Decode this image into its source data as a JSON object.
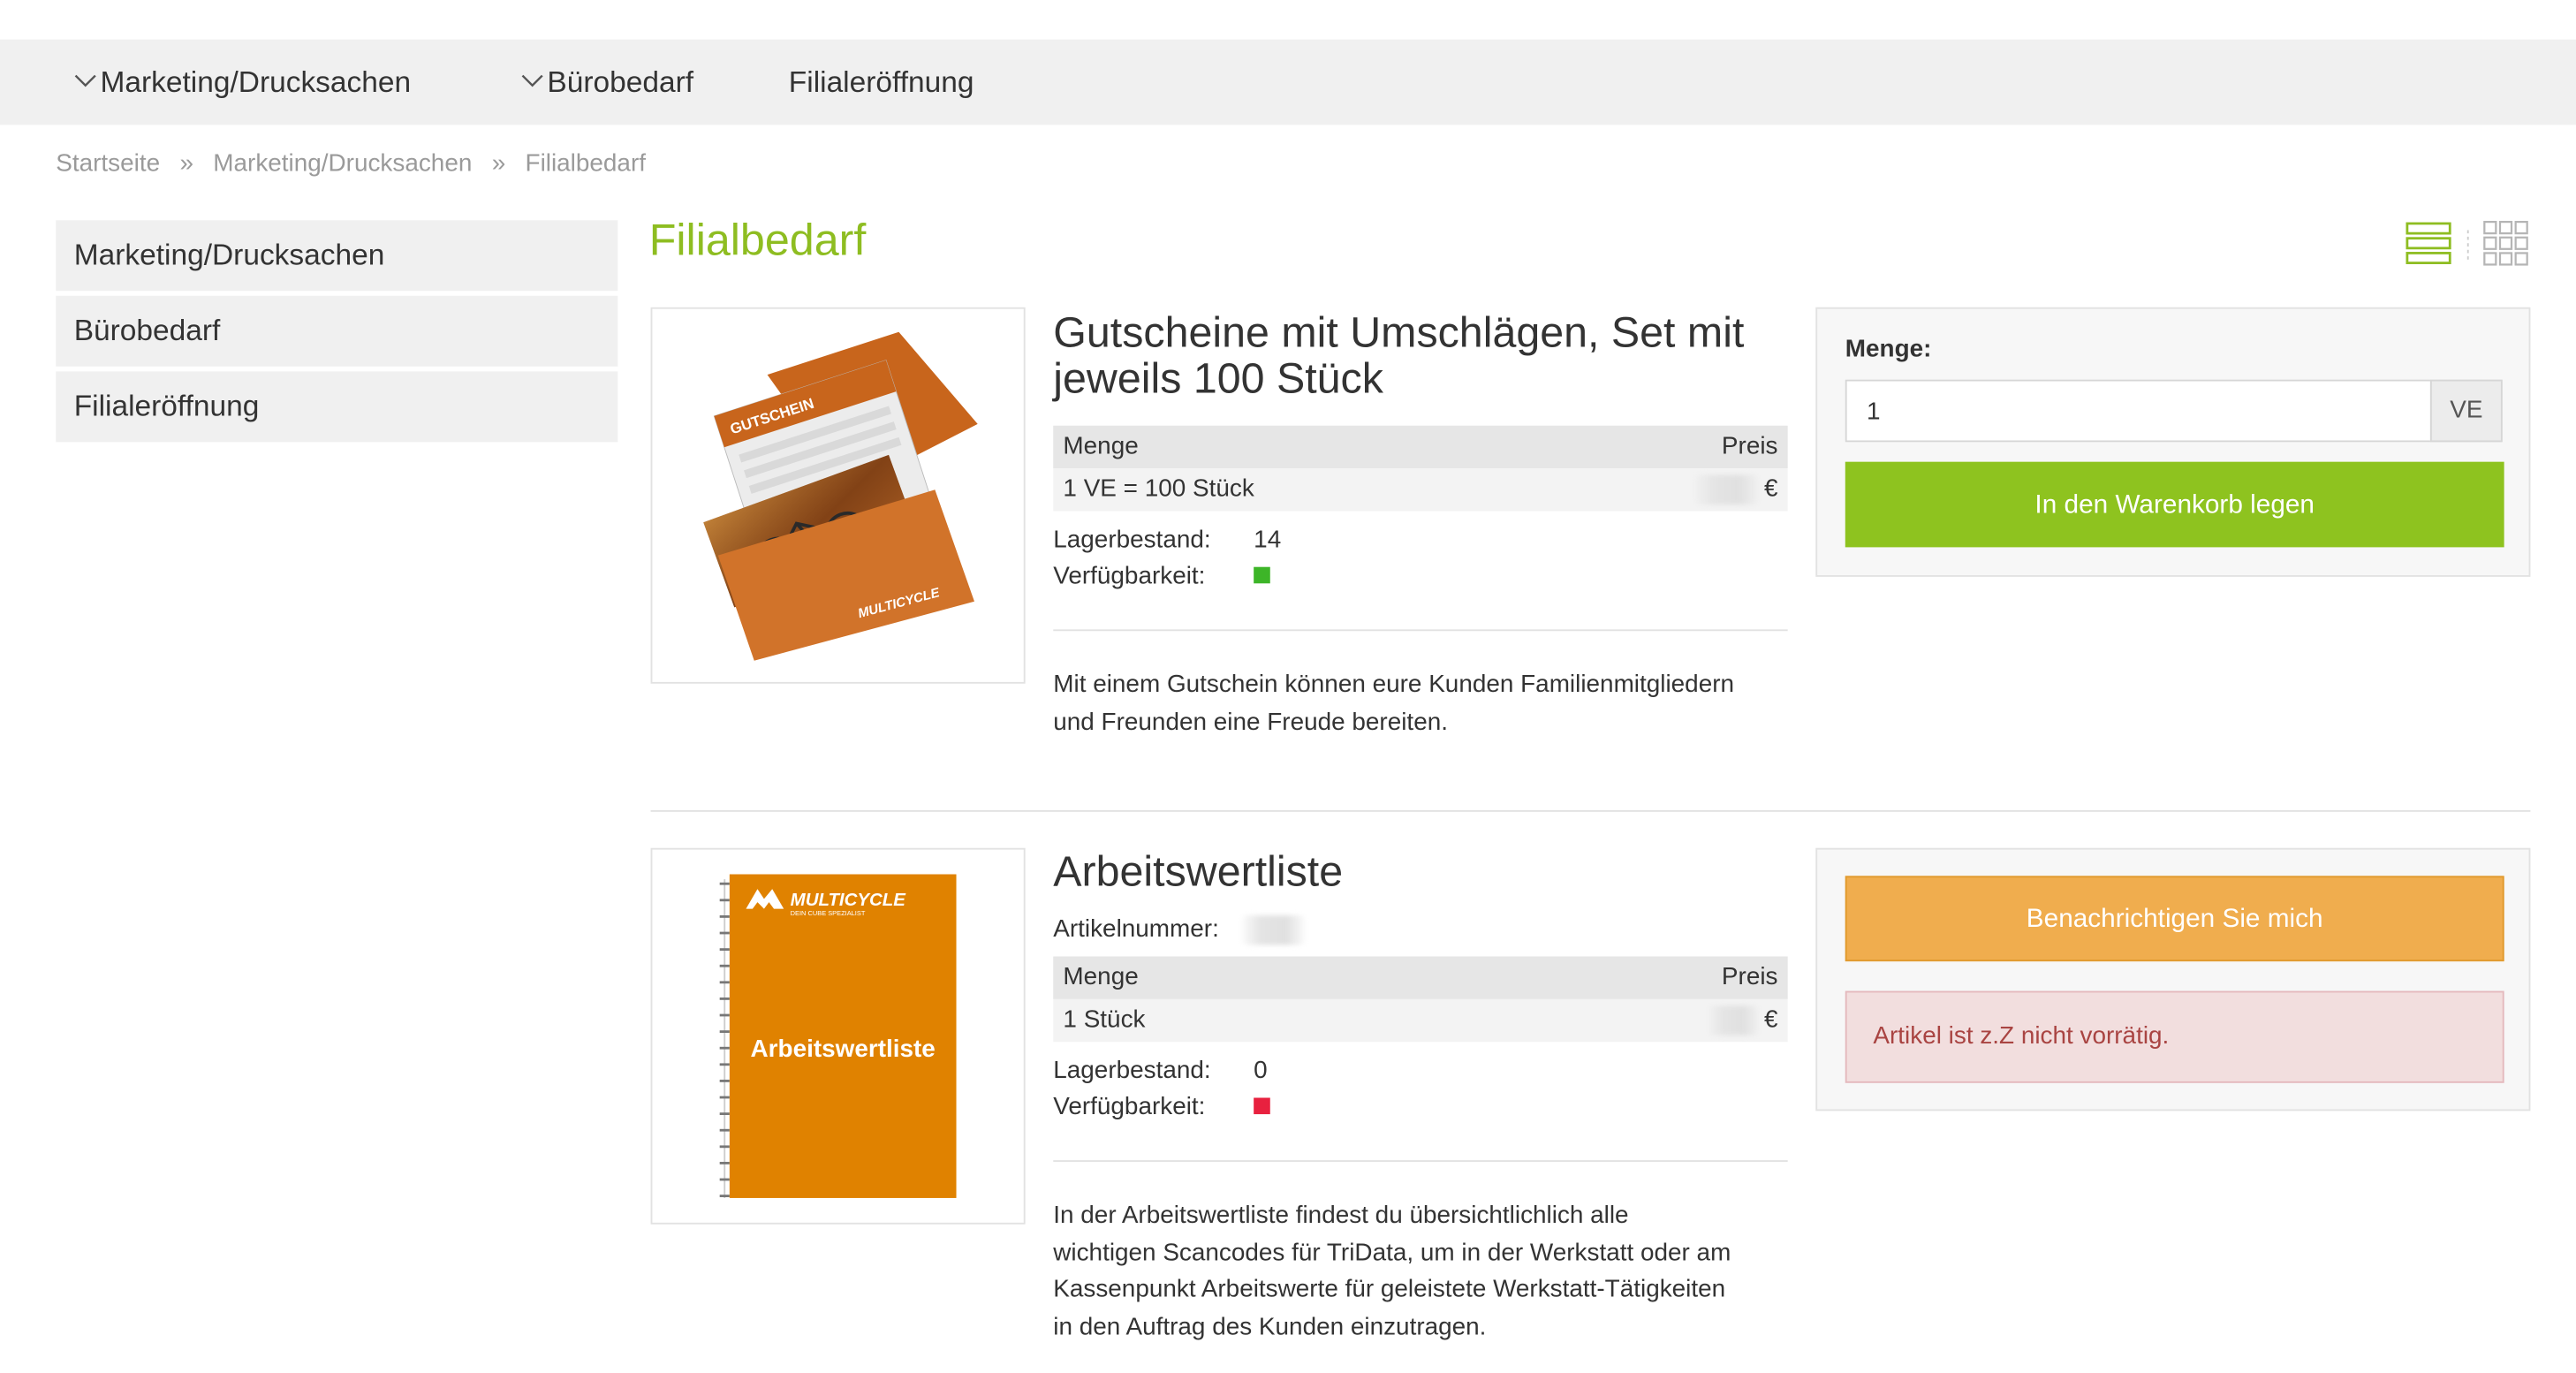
{
  "nav": {
    "items": [
      {
        "label": "Marketing/Drucksachen",
        "has_dropdown": true
      },
      {
        "label": "Bürobedarf",
        "has_dropdown": true
      },
      {
        "label": "Filialeröffnung",
        "has_dropdown": false
      }
    ]
  },
  "breadcrumb": {
    "items": [
      "Startseite",
      "Marketing/Drucksachen",
      "Filialbedarf"
    ],
    "separator": "»"
  },
  "sidebar": {
    "items": [
      {
        "label": "Marketing/Drucksachen"
      },
      {
        "label": "Bürobedarf"
      },
      {
        "label": "Filialeröffnung"
      }
    ]
  },
  "page": {
    "title": "Filialbedarf",
    "view_modes": [
      "list-view-icon",
      "grid-view-icon"
    ],
    "active_view": "list"
  },
  "products": [
    {
      "title_line1": "Gutscheine mit Umschlägen, Set mit",
      "title_line2": "jeweils 100 Stück",
      "price_table": {
        "col_qty": "Menge",
        "col_price": "Preis",
        "qty": "1 VE = 100 Stück",
        "currency": "€"
      },
      "stock_label": "Lagerbestand:",
      "stock_value": "14",
      "availability_label": "Verfügbarkeit:",
      "availability_color": "#3db528",
      "desc_line1": "Mit einem Gutschein können eure Kunden Familienmitgliedern",
      "desc_line2": "und Freunden eine Freude bereiten.",
      "image_text": {
        "voucher": "GUTSCHEIN",
        "brand": "MULTICYCLE"
      },
      "buy": {
        "qty_label": "Menge:",
        "qty_value": "1",
        "unit": "VE",
        "button": "In den Warenkorb legen"
      }
    },
    {
      "title": "Arbeitswertliste",
      "article_label": "Artikelnummer:",
      "price_table": {
        "col_qty": "Menge",
        "col_price": "Preis",
        "qty": "1 Stück",
        "currency": "€"
      },
      "stock_label": "Lagerbestand:",
      "stock_value": "0",
      "availability_label": "Verfügbarkeit:",
      "availability_color": "#e8213f",
      "desc_lines": [
        "In der Arbeitswertliste findest du übersichtlichlich alle",
        "wichtigen Scancodes für TriData, um in der Werkstatt oder am",
        "Kassenpunkt Arbeitswerte für geleistete Werkstatt-Tätigkeiten",
        "in den Auftrag des Kunden einzutragen."
      ],
      "image_text": {
        "brand": "MULTICYCLE",
        "tagline": "DEIN CUBE SPEZIALIST",
        "cover_title": "Arbeitswertliste"
      },
      "buy": {
        "notify_button": "Benachrichtigen Sie mich",
        "alert": "Artikel ist z.Z nicht vorrätig."
      }
    }
  ],
  "colors": {
    "accent_green": "#8ebd21",
    "button_green": "#8ec31f",
    "button_orange": "#f0ad4e",
    "alert_bg": "#f2dede",
    "alert_text": "#a94442"
  }
}
